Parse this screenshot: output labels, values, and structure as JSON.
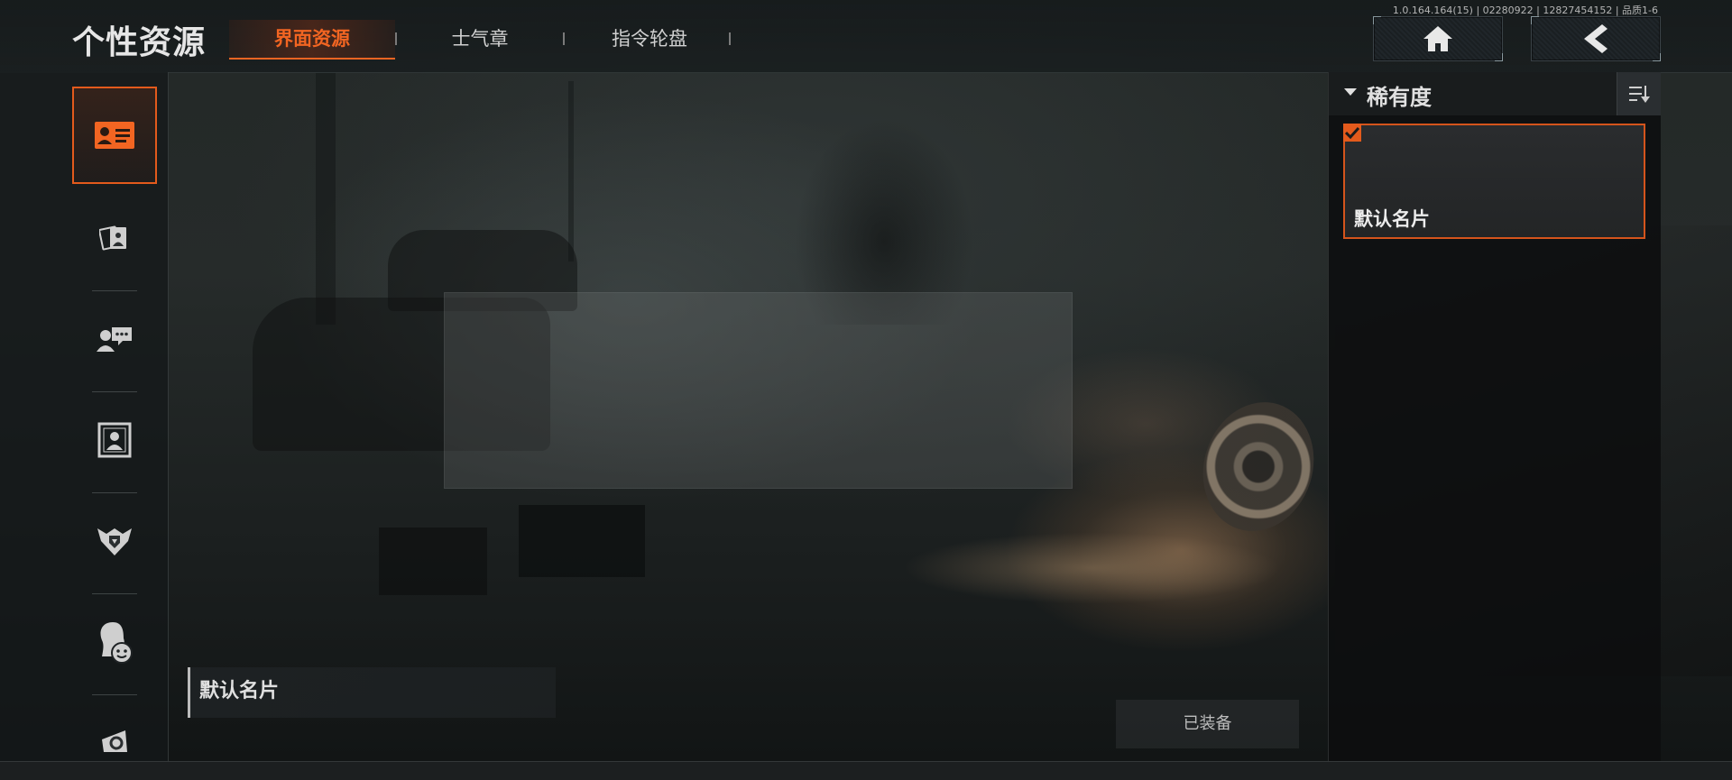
{
  "header": {
    "title": "个性资源",
    "version": "1.0.164.164(15) | 02280922 | 12827454152 | 品质1-6",
    "tabs": [
      {
        "label": "界面资源",
        "active": true
      },
      {
        "label": "士气章",
        "active": false
      },
      {
        "label": "指令轮盘",
        "active": false
      }
    ],
    "home_icon": "home-icon",
    "back_icon": "back-chevron-icon"
  },
  "sidebar": {
    "items": [
      {
        "icon": "name-card-icon",
        "active": true
      },
      {
        "icon": "photo-cards-icon",
        "active": false
      },
      {
        "icon": "chat-bubble-user-icon",
        "active": false
      },
      {
        "icon": "portrait-frame-icon",
        "active": false
      },
      {
        "icon": "rank-badge-icon",
        "active": false
      },
      {
        "icon": "emote-head-icon",
        "active": false
      },
      {
        "icon": "spray-icon",
        "active": false
      }
    ]
  },
  "main": {
    "selected_name": "默认名片",
    "equipped_label": "已装备"
  },
  "filter_panel": {
    "title": "稀有度",
    "sort_icon": "sort-icon",
    "cards": [
      {
        "name": "默认名片",
        "checked": true
      }
    ]
  },
  "colors": {
    "accent": "#e35a1c",
    "tab_active": "#f26522"
  }
}
